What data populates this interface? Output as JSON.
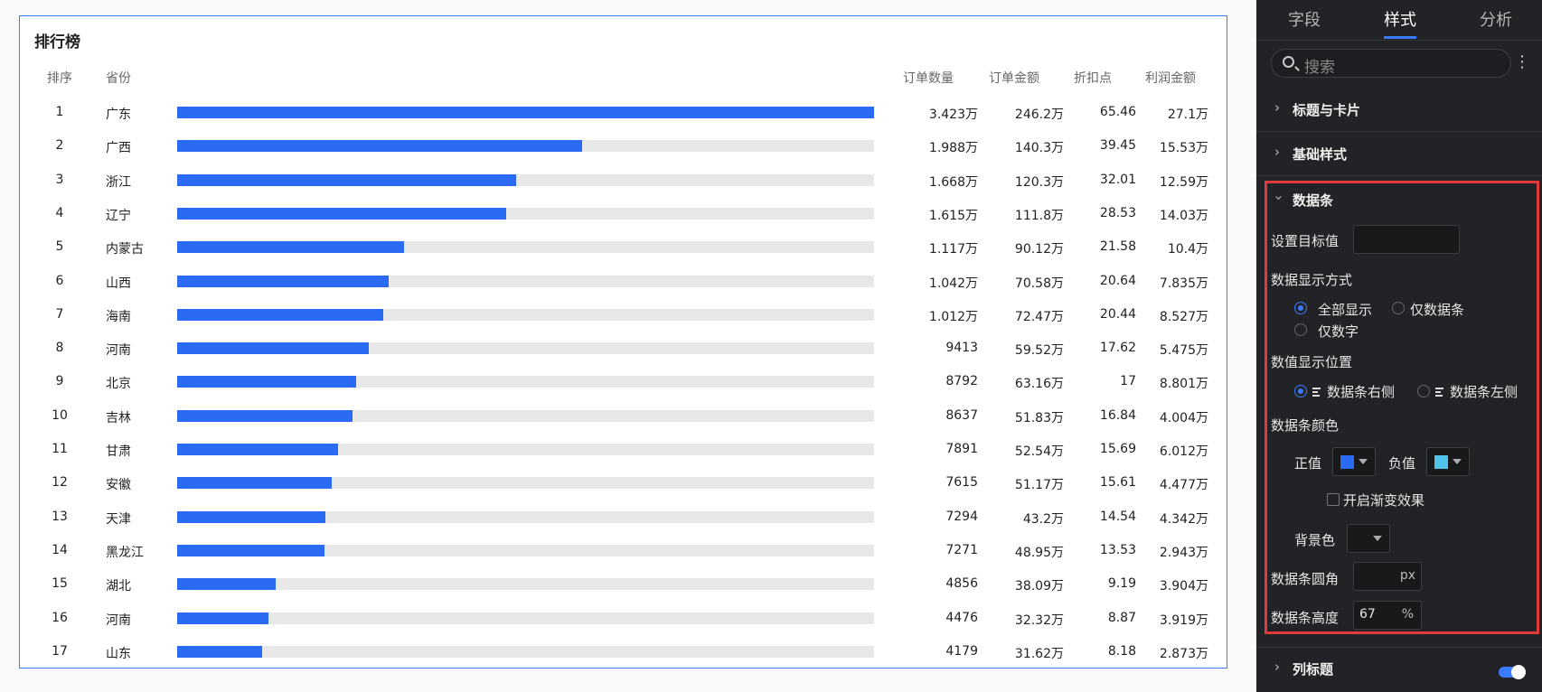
{
  "card": {
    "title": "排行榜",
    "headers": {
      "rank": "排序",
      "province": "省份",
      "order_count": "订单数量",
      "order_amount": "订单金额",
      "discount": "折扣点",
      "profit": "利润金额"
    }
  },
  "table": {
    "rows": [
      {
        "rank": "1",
        "province": "广东",
        "bar": 1.0,
        "order_count": "3.423万",
        "order_amount": "246.2万",
        "discount": "65.46",
        "profit": "27.1万"
      },
      {
        "rank": "2",
        "province": "广西",
        "bar": 0.581,
        "order_count": "1.988万",
        "order_amount": "140.3万",
        "discount": "39.45",
        "profit": "15.53万"
      },
      {
        "rank": "3",
        "province": "浙江",
        "bar": 0.487,
        "order_count": "1.668万",
        "order_amount": "120.3万",
        "discount": "32.01",
        "profit": "12.59万"
      },
      {
        "rank": "4",
        "province": "辽宁",
        "bar": 0.472,
        "order_count": "1.615万",
        "order_amount": "111.8万",
        "discount": "28.53",
        "profit": "14.03万"
      },
      {
        "rank": "5",
        "province": "内蒙古",
        "bar": 0.326,
        "order_count": "1.117万",
        "order_amount": "90.12万",
        "discount": "21.58",
        "profit": "10.4万"
      },
      {
        "rank": "6",
        "province": "山西",
        "bar": 0.304,
        "order_count": "1.042万",
        "order_amount": "70.58万",
        "discount": "20.64",
        "profit": "7.835万"
      },
      {
        "rank": "7",
        "province": "海南",
        "bar": 0.296,
        "order_count": "1.012万",
        "order_amount": "72.47万",
        "discount": "20.44",
        "profit": "8.527万"
      },
      {
        "rank": "8",
        "province": "河南",
        "bar": 0.275,
        "order_count": "9413",
        "order_amount": "59.52万",
        "discount": "17.62",
        "profit": "5.475万"
      },
      {
        "rank": "9",
        "province": "北京",
        "bar": 0.257,
        "order_count": "8792",
        "order_amount": "63.16万",
        "discount": "17",
        "profit": "8.801万"
      },
      {
        "rank": "10",
        "province": "吉林",
        "bar": 0.252,
        "order_count": "8637",
        "order_amount": "51.83万",
        "discount": "16.84",
        "profit": "4.004万"
      },
      {
        "rank": "11",
        "province": "甘肃",
        "bar": 0.231,
        "order_count": "7891",
        "order_amount": "52.54万",
        "discount": "15.69",
        "profit": "6.012万"
      },
      {
        "rank": "12",
        "province": "安徽",
        "bar": 0.222,
        "order_count": "7615",
        "order_amount": "51.17万",
        "discount": "15.61",
        "profit": "4.477万"
      },
      {
        "rank": "13",
        "province": "天津",
        "bar": 0.213,
        "order_count": "7294",
        "order_amount": "43.2万",
        "discount": "14.54",
        "profit": "4.342万"
      },
      {
        "rank": "14",
        "province": "黑龙江",
        "bar": 0.212,
        "order_count": "7271",
        "order_amount": "48.95万",
        "discount": "13.53",
        "profit": "2.943万"
      },
      {
        "rank": "15",
        "province": "湖北",
        "bar": 0.142,
        "order_count": "4856",
        "order_amount": "38.09万",
        "discount": "9.19",
        "profit": "3.904万"
      },
      {
        "rank": "16",
        "province": "河南",
        "bar": 0.131,
        "order_count": "4476",
        "order_amount": "32.32万",
        "discount": "8.87",
        "profit": "3.919万"
      },
      {
        "rank": "17",
        "province": "山东",
        "bar": 0.122,
        "order_count": "4179",
        "order_amount": "31.62万",
        "discount": "8.18",
        "profit": "2.873万"
      }
    ]
  },
  "panel": {
    "tabs": [
      "字段",
      "样式",
      "分析"
    ],
    "active_tab": "样式",
    "search_placeholder": "搜索",
    "sections": {
      "title_card": "标题与卡片",
      "basic_style": "基础样式",
      "data_bar": "数据条",
      "column_title": "列标题"
    },
    "data_bar": {
      "target_label": "设置目标值",
      "target_value": "",
      "display_mode_label": "数据显示方式",
      "display_options": [
        "全部显示",
        "仅数据条",
        "仅数字"
      ],
      "display_selected": "全部显示",
      "value_pos_label": "数值显示位置",
      "value_pos_options": [
        "数据条右侧",
        "数据条左侧"
      ],
      "value_pos_selected": "数据条右侧",
      "color_label": "数据条颜色",
      "positive_label": "正值",
      "positive_color": "#2b6bf4",
      "negative_label": "负值",
      "negative_color": "#4fc3ea",
      "gradient_label": "开启渐变效果",
      "bg_label": "背景色",
      "bg_color": "#18191b",
      "radius_label": "数据条圆角",
      "radius_value": "",
      "radius_unit": "px",
      "height_label": "数据条高度",
      "height_value": "67",
      "height_unit": "%"
    },
    "column_title_enabled": true
  }
}
